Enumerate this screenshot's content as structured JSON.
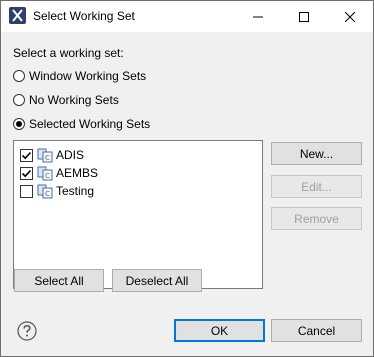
{
  "window": {
    "title": "Select Working Set",
    "controls": {
      "minimize": "minimize-icon",
      "maximize": "maximize-icon",
      "close": "close-icon"
    }
  },
  "prompt": "Select a working set:",
  "radios": [
    {
      "label": "Window Working Sets",
      "selected": false
    },
    {
      "label": "No Working Sets",
      "selected": false
    },
    {
      "label": "Selected Working Sets",
      "selected": true
    }
  ],
  "working_sets": [
    {
      "label": "ADIS",
      "checked": true
    },
    {
      "label": "AEMBS",
      "checked": true
    },
    {
      "label": "Testing",
      "checked": false
    }
  ],
  "side_buttons": {
    "new": "New...",
    "edit": "Edit...",
    "remove": "Remove"
  },
  "list_buttons": {
    "select_all": "Select All",
    "deselect_all": "Deselect All"
  },
  "footer": {
    "ok": "OK",
    "cancel": "Cancel",
    "help_icon": "help-icon"
  },
  "colors": {
    "title_bg": "#ffffff",
    "dialog_bg": "#f0f0f0",
    "accent": "#0078d7"
  }
}
